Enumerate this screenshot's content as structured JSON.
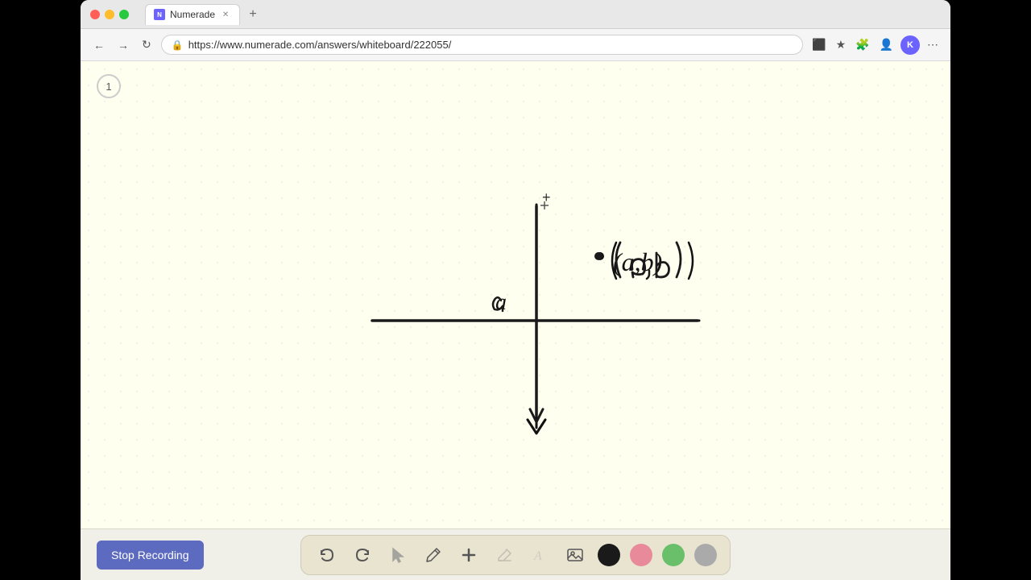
{
  "browser": {
    "tab_title": "Numerade",
    "tab_favicon": "N",
    "url": "https://www.numerade.com/answers/whiteboard/222055/",
    "nav": {
      "back_label": "←",
      "forward_label": "→",
      "refresh_label": "↻",
      "more_label": "⋯"
    }
  },
  "page": {
    "number": "1"
  },
  "toolbar": {
    "stop_recording_label": "Stop Recording",
    "tools": [
      {
        "name": "undo",
        "icon": "↩",
        "label": "Undo"
      },
      {
        "name": "redo",
        "icon": "↪",
        "label": "Redo"
      },
      {
        "name": "select",
        "icon": "↖",
        "label": "Select"
      },
      {
        "name": "pen",
        "icon": "✏",
        "label": "Pen"
      },
      {
        "name": "add",
        "icon": "+",
        "label": "Add"
      },
      {
        "name": "eraser",
        "icon": "⌫",
        "label": "Eraser"
      },
      {
        "name": "text",
        "icon": "A",
        "label": "Text"
      },
      {
        "name": "image",
        "icon": "🖼",
        "label": "Image"
      }
    ],
    "colors": [
      {
        "name": "black",
        "value": "#1a1a1a"
      },
      {
        "name": "pink",
        "value": "#e88a9a"
      },
      {
        "name": "green",
        "value": "#6abf6a"
      },
      {
        "name": "gray",
        "value": "#aaaaaa"
      }
    ]
  }
}
